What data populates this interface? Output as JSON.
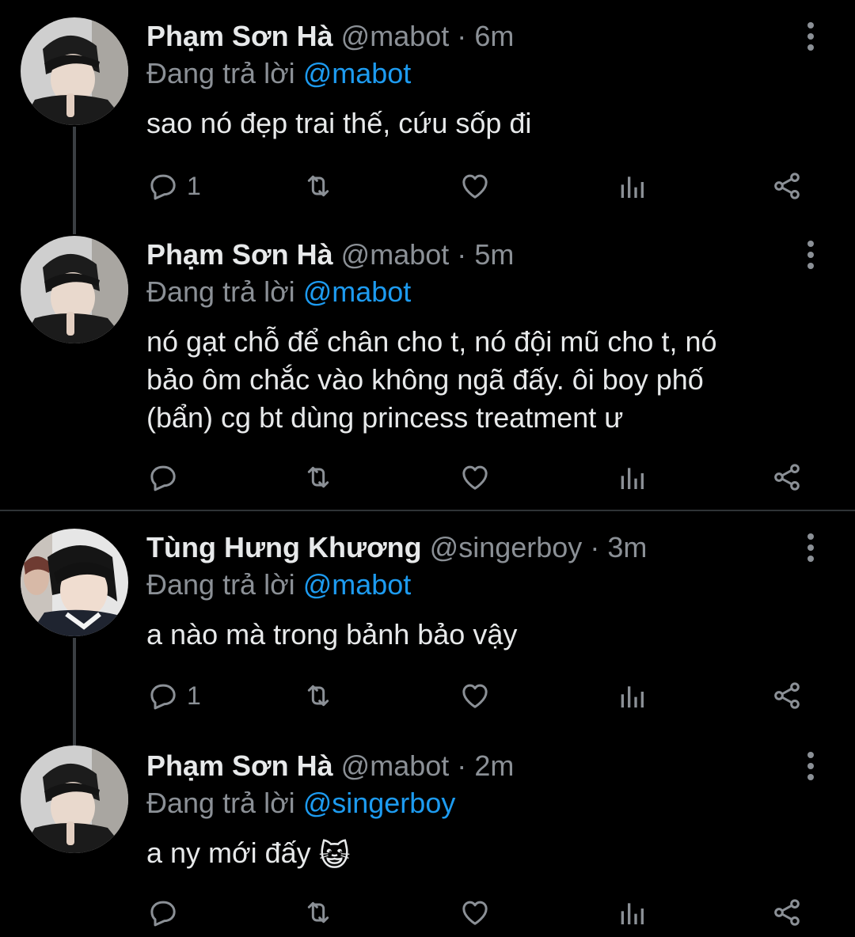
{
  "colors": {
    "background": "#000000",
    "text": "#e7e9ea",
    "secondary": "#8b9096",
    "mention": "#1d9bf0",
    "thread_line": "#3b3f43"
  },
  "reply_prefix": "Đang trả lời",
  "tweets": [
    {
      "name": "Phạm Sơn Hà",
      "handle": "@mabot",
      "separator": "·",
      "time": "6m",
      "reply_to": "@mabot",
      "text": "sao nó đẹp trai thế, cứu sốp đi",
      "reply_count": "1"
    },
    {
      "name": "Phạm Sơn Hà",
      "handle": "@mabot",
      "separator": "·",
      "time": "5m",
      "reply_to": "@mabot",
      "text_lines": [
        "nó gạt chỗ để chân cho t, nó đội mũ cho t, nó",
        "bảo ôm chắc vào không ngã đấy. ôi boy phố",
        "(bẩn) cg bt dùng princess treatment ư"
      ],
      "reply_count": ""
    },
    {
      "name": "Tùng Hưng Khương",
      "handle": "@singerboy",
      "separator": "·",
      "time": "3m",
      "reply_to": "@mabot",
      "text": "a nào mà trong bảnh bảo vậy",
      "reply_count": "1"
    },
    {
      "name": "Phạm Sơn Hà",
      "handle": "@mabot",
      "separator": "·",
      "time": "2m",
      "reply_to": "@singerboy",
      "text": "a ny mới đấy",
      "emoji": "😺",
      "reply_count": ""
    }
  ],
  "icons": {
    "reply": "reply-icon",
    "retweet": "retweet-icon",
    "like": "heart-icon",
    "stats": "stats-icon",
    "share": "share-icon",
    "more": "more-vertical-icon"
  }
}
